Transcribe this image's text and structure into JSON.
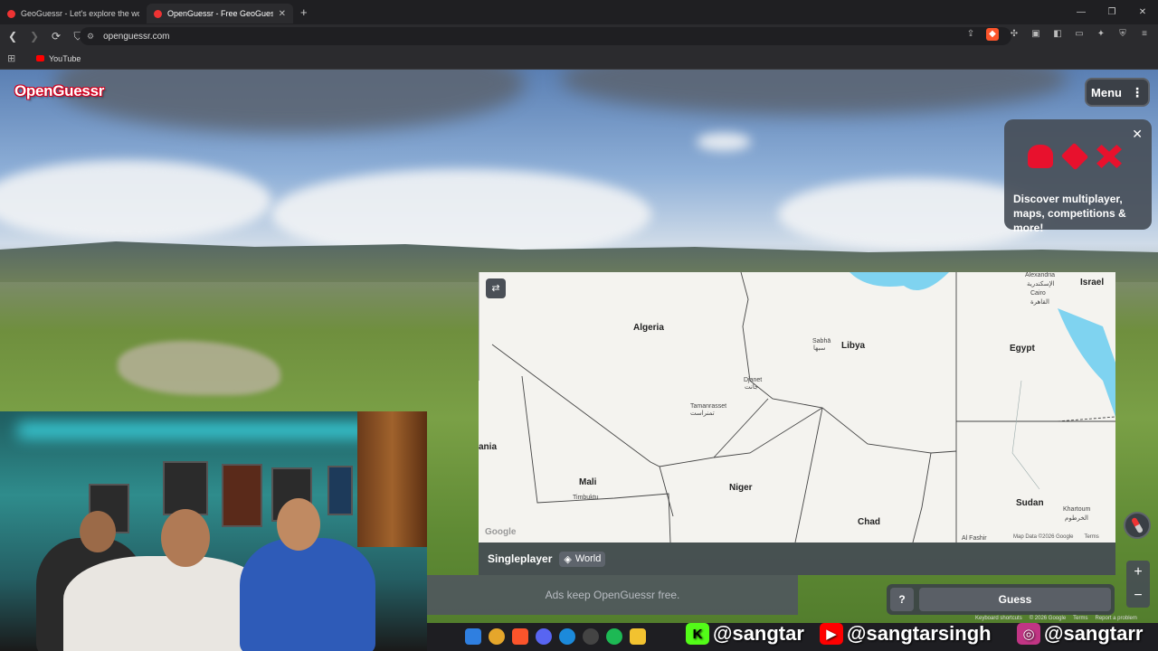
{
  "browser": {
    "tabs": [
      {
        "title": "GeoGuessr - Let's explore the world!"
      },
      {
        "title": "OpenGuessr - Free GeoGuess"
      }
    ],
    "url": "openguessr.com",
    "bookmark": "YouTube"
  },
  "game": {
    "logo": "OpenGuessr",
    "menu_label": "Menu",
    "promo_text": "Discover multiplayer, maps, competitions & more!",
    "mode": "Singleplayer",
    "map_name": "World",
    "ad_text": "Ads keep OpenGuessr free.",
    "help_label": "?",
    "guess_label": "Guess",
    "zoom_in": "+",
    "zoom_out": "−",
    "footer_links": [
      "Keyboard shortcuts",
      "© 2026 Google",
      "Terms",
      "Report a problem"
    ]
  },
  "map": {
    "countries": [
      "Algeria",
      "Libya",
      "Egypt",
      "Mali",
      "Niger",
      "Chad",
      "Sudan",
      "Israel",
      "ania"
    ],
    "cities": [
      "Alexandria",
      "الإسكندرية",
      "Cairo",
      "القاهرة",
      "Sabhā",
      "سبها",
      "Djanet",
      "جانت",
      "Tamanrasset",
      "تمنراست",
      "Timbuktu",
      "Khartoum",
      "الخرطوم",
      "Al Fashir"
    ],
    "attribution": "Map Data ©2026 Google",
    "terms": "Terms",
    "google_mark": "Google"
  },
  "socials": {
    "kick": "@sangtar",
    "youtube": "@sangtarsingh",
    "instagram": "@sangtarr"
  },
  "colors": {
    "brand_red": "#e8112d",
    "panel": "#464c54",
    "water": "#7fd3f0"
  }
}
